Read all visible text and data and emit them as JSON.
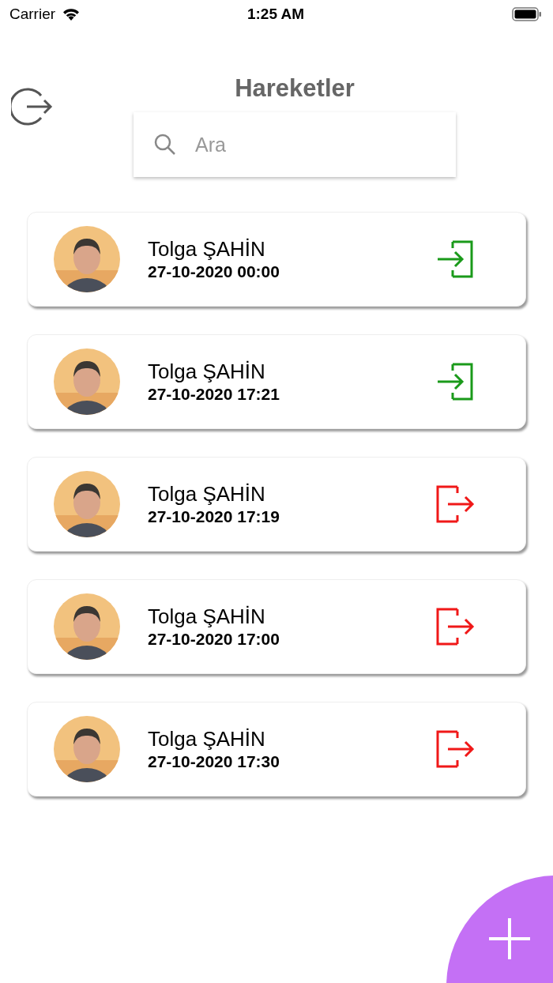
{
  "status_bar": {
    "carrier": "Carrier",
    "time": "1:25 AM"
  },
  "header": {
    "title": "Hareketler"
  },
  "search": {
    "placeholder": "Ara"
  },
  "entries": [
    {
      "name": "Tolga ŞAHİN",
      "datetime": "27-10-2020 00:00",
      "kind": "in"
    },
    {
      "name": "Tolga ŞAHİN",
      "datetime": "27-10-2020 17:21",
      "kind": "in"
    },
    {
      "name": "Tolga ŞAHİN",
      "datetime": "27-10-2020 17:19",
      "kind": "out"
    },
    {
      "name": "Tolga ŞAHİN",
      "datetime": "27-10-2020 17:00",
      "kind": "out"
    },
    {
      "name": "Tolga ŞAHİN",
      "datetime": "27-10-2020 17:30",
      "kind": "out"
    }
  ]
}
